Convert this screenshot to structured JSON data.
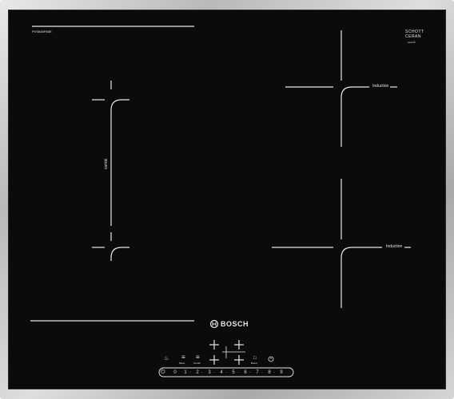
{
  "model_code": "PVS645FB5E",
  "schott": {
    "line1": "SCHOTT",
    "line2": "CERAN",
    "line3": "ceran®"
  },
  "zones": {
    "combi_label": "combi",
    "induction_top_label": "Induction",
    "induction_bottom_label": "Induction"
  },
  "brand": {
    "name": "BOSCH"
  },
  "controls": {
    "scale": [
      "0",
      "1",
      "·",
      "2",
      "·",
      "3",
      "·",
      "4",
      "·",
      "5",
      "·",
      "6",
      "·",
      "7",
      "·",
      "8",
      "·",
      "9"
    ],
    "icon_labels": {
      "move": "Move",
      "combi": "Combi",
      "boost": "Boost"
    }
  }
}
